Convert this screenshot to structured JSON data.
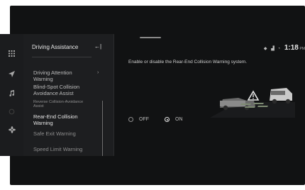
{
  "sidebar": {
    "title": "Driving Assistance",
    "back_icon": "back-arrow-icon",
    "items": [
      {
        "label": "Driving Attention Warning",
        "state": "normal"
      },
      {
        "label": "Blind-Spot Collision Avoidance Assist",
        "state": "normal"
      },
      {
        "label": "Reverse Collision-Avoidance Assist",
        "state": "sub"
      },
      {
        "label": "Rear-End Collision Warning",
        "state": "active"
      },
      {
        "label": "Safe Exit Warning",
        "state": "dim"
      },
      {
        "label": "Speed Limit Warning",
        "state": "dim"
      }
    ]
  },
  "rail_icons": [
    "grid-icon",
    "navigation-icon",
    "music-icon",
    "settings-icon",
    "fan-icon"
  ],
  "status": {
    "icons": [
      "location-icon",
      "signal-icon",
      "wifi-icon"
    ],
    "time": "1:18",
    "ampm": "PM"
  },
  "content": {
    "description": "Enable or disable the Rear-End Collision Warning system.",
    "options": [
      {
        "label": "OFF",
        "selected": false
      },
      {
        "label": "ON",
        "selected": true
      }
    ]
  },
  "colors": {
    "background": "#111213",
    "panel": "#1d1e20",
    "text": "#d6d6d6"
  }
}
